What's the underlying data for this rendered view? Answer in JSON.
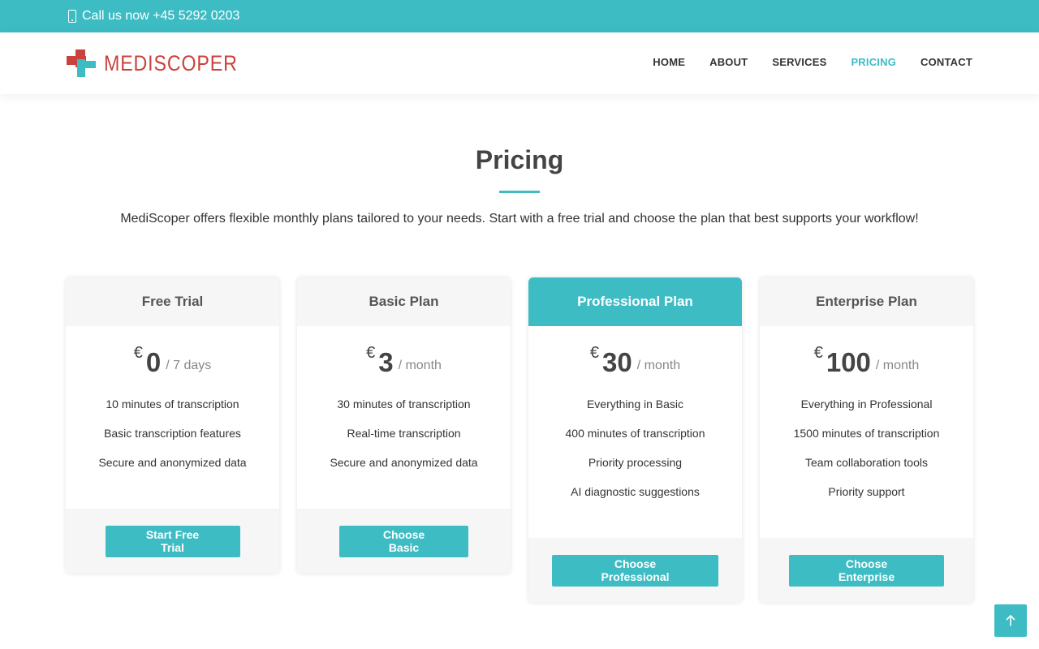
{
  "topbar": {
    "phone_text": "Call us now +45 5292 0203",
    "phone_icon": "mobile-phone-icon"
  },
  "header": {
    "logo_text": "MEDISCOPER",
    "nav": [
      {
        "label": "HOME",
        "active": false
      },
      {
        "label": "ABOUT",
        "active": false
      },
      {
        "label": "SERVICES",
        "active": false
      },
      {
        "label": "PRICING",
        "active": true
      },
      {
        "label": "CONTACT",
        "active": false
      }
    ]
  },
  "section": {
    "title": "Pricing",
    "intro": "MediScoper offers flexible monthly plans tailored to your needs. Start with a free trial and choose the plan that best supports your workflow!"
  },
  "plans": [
    {
      "name": "Free Trial",
      "currency": "€",
      "amount": "0",
      "period": "/ 7 days",
      "features": [
        "10 minutes of transcription",
        "Basic transcription features",
        "Secure and anonymized data"
      ],
      "button": "Start Free Trial",
      "featured": false
    },
    {
      "name": "Basic Plan",
      "currency": "€",
      "amount": "3",
      "period": "/ month",
      "features": [
        "30 minutes of transcription",
        "Real-time transcription",
        "Secure and anonymized data"
      ],
      "button": "Choose Basic",
      "featured": false
    },
    {
      "name": "Professional Plan",
      "currency": "€",
      "amount": "30",
      "period": "/ month",
      "features": [
        "Everything in Basic",
        "400 minutes of transcription",
        "Priority processing",
        "AI diagnostic suggestions"
      ],
      "button": "Choose Professional",
      "featured": true
    },
    {
      "name": "Enterprise Plan",
      "currency": "€",
      "amount": "100",
      "period": "/ month",
      "features": [
        "Everything in Professional",
        "1500 minutes of transcription",
        "Team collaboration tools",
        "Priority support"
      ],
      "button": "Choose Enterprise",
      "featured": false
    }
  ],
  "colors": {
    "accent": "#3dbcc4",
    "brand_red": "#c9423b"
  },
  "back_to_top_icon": "arrow-up-icon"
}
